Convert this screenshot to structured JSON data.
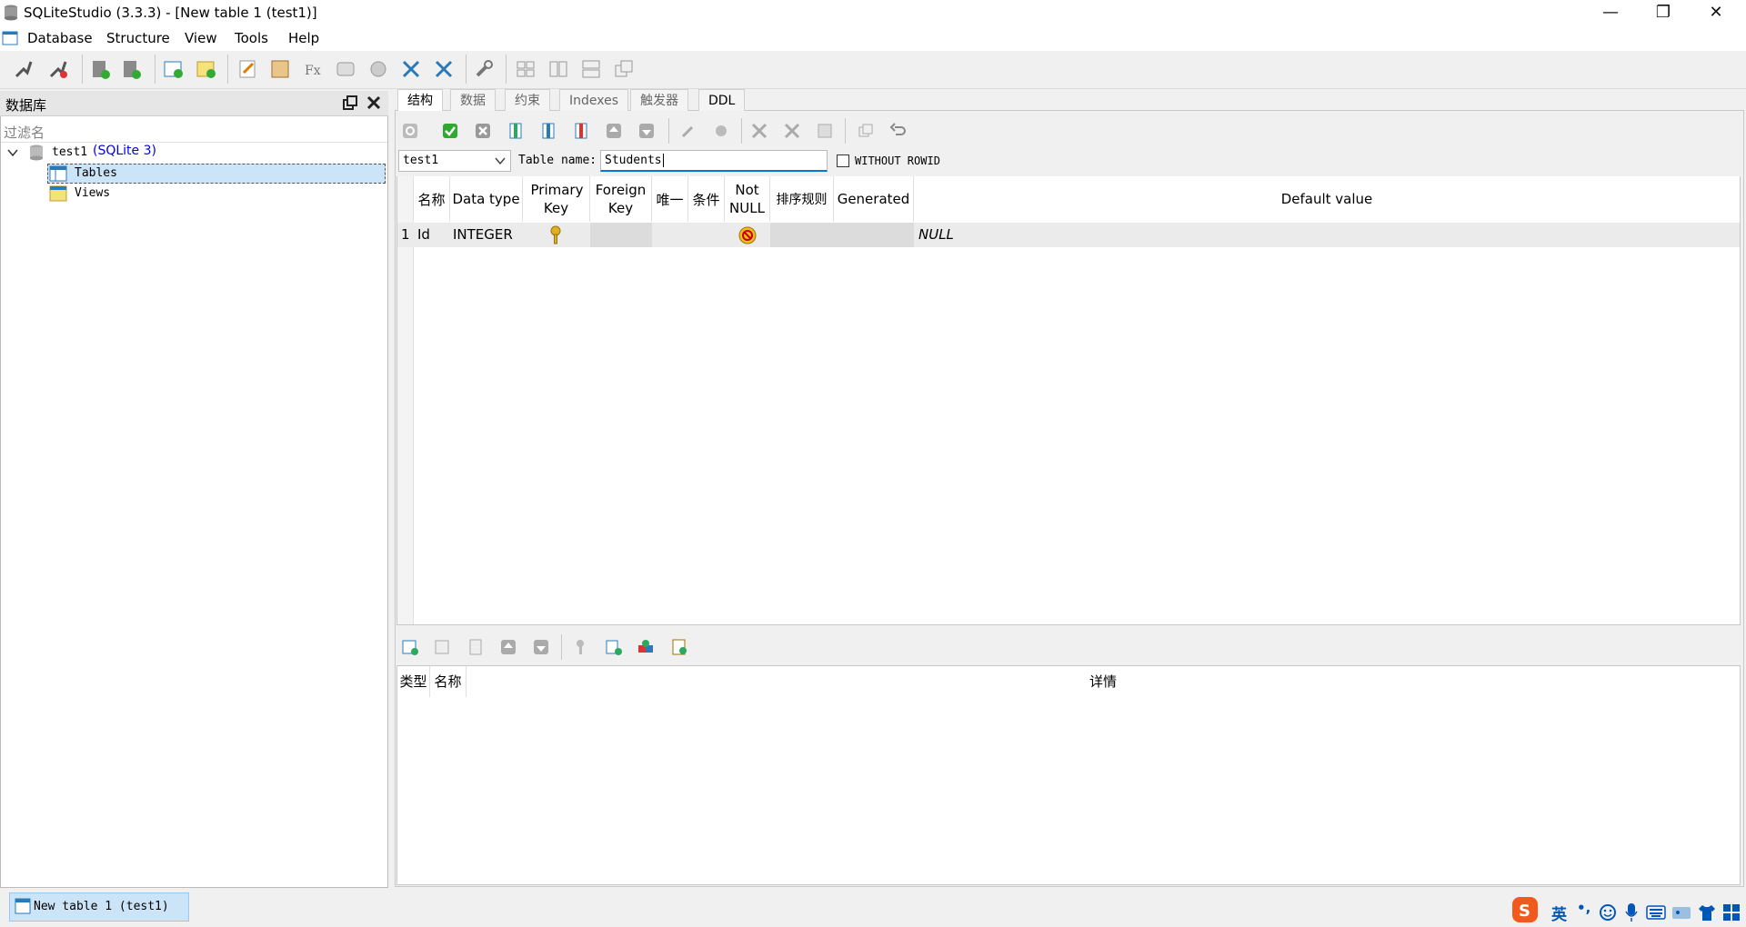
{
  "window": {
    "title": "SQLiteStudio (3.3.3) - [New table 1 (test1)]",
    "minimize": "—",
    "restore": "❐",
    "close": "✕"
  },
  "menu": {
    "database": "Database",
    "structure": "Structure",
    "view": "View",
    "tools": "Tools",
    "help": "Help"
  },
  "left_panel": {
    "title": "数据库",
    "filter_placeholder": "过滤名",
    "tree": {
      "db_name": "test1",
      "db_type": "(SQLite 3)",
      "tables": "Tables",
      "views": "Views"
    }
  },
  "tabs": [
    "结构",
    "数据",
    "约束",
    "Indexes",
    "触发器",
    "DDL"
  ],
  "editor": {
    "database_select": "test1",
    "table_name_label": "Table name:",
    "table_name_value": "Students",
    "without_rowid_label": "WITHOUT ROWID",
    "without_rowid_checked": false
  },
  "columns_table": {
    "headers": [
      "名称",
      "Data type",
      "Primary Key",
      "Foreign Key",
      "唯一",
      "条件",
      "Not NULL",
      "排序规则",
      "Generated",
      "Default value"
    ],
    "rows": [
      {
        "num": "1",
        "name": "Id",
        "type": "INTEGER",
        "primary_key": true,
        "not_null": true,
        "default": "NULL"
      }
    ]
  },
  "constraints_table": {
    "headers": [
      "类型",
      "名称",
      "详情"
    ]
  },
  "taskbar": {
    "item": "New table 1 (test1)"
  },
  "tray": {
    "ime": "英",
    "punct": "•,"
  },
  "colors": {
    "accent": "#0078d7",
    "active_input_border": "#0078d7",
    "selection": "#cce4f7"
  }
}
